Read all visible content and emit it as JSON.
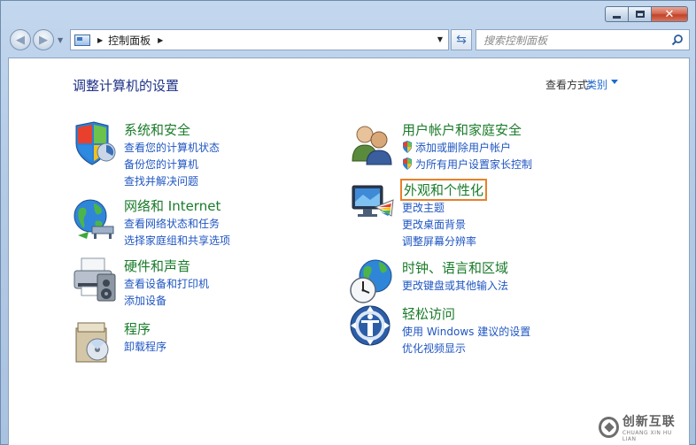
{
  "window": {
    "close_glyph": "✕"
  },
  "address": {
    "crumb": "控制面板",
    "search_placeholder": "搜索控制面板"
  },
  "main": {
    "heading": "调整计算机的设置",
    "view_by_label": "查看方式:",
    "view_by_value": "类别"
  },
  "categories_left": [
    {
      "title": "系统和安全",
      "links": [
        "查看您的计算机状态",
        "备份您的计算机",
        "查找并解决问题"
      ]
    },
    {
      "title": "网络和 Internet",
      "links": [
        "查看网络状态和任务",
        "选择家庭组和共享选项"
      ]
    },
    {
      "title": "硬件和声音",
      "links": [
        "查看设备和打印机",
        "添加设备"
      ]
    },
    {
      "title": "程序",
      "links": [
        "卸载程序"
      ]
    }
  ],
  "categories_right": [
    {
      "title": "用户帐户和家庭安全",
      "links": [
        "添加或删除用户帐户",
        "为所有用户设置家长控制"
      ]
    },
    {
      "title": "外观和个性化",
      "links": [
        "更改主题",
        "更改桌面背景",
        "调整屏幕分辨率"
      ]
    },
    {
      "title": "时钟、语言和区域",
      "links": [
        "更改键盘或其他输入法"
      ]
    },
    {
      "title": "轻松访问",
      "links": [
        "使用 Windows 建议的设置",
        "优化视频显示"
      ]
    }
  ],
  "watermark": {
    "cn": "创新互联",
    "en": "CHUANG XIN HU LIAN"
  },
  "colors": {
    "category_title": "#1a7b2a",
    "link": "#1f56c2",
    "heading": "#1e3287",
    "highlight_border": "#e8802c"
  }
}
